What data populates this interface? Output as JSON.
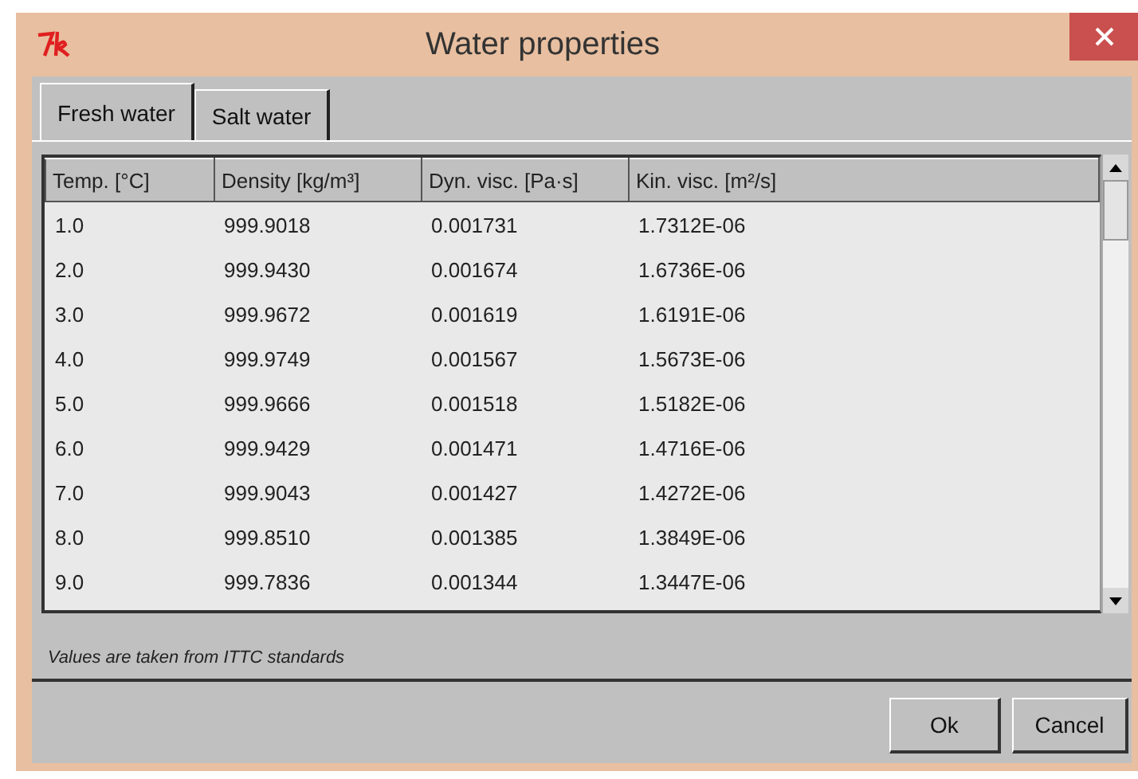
{
  "window": {
    "title": "Water properties"
  },
  "tabs": [
    {
      "label": "Fresh water",
      "selected": true
    },
    {
      "label": "Salt water",
      "selected": false
    }
  ],
  "table": {
    "columns": [
      "Temp. [°C]",
      "Density [kg/m³]",
      "Dyn. visc. [Pa·s]",
      "Kin. visc. [m²/s]"
    ],
    "rows": [
      [
        "1.0",
        "999.9018",
        "0.001731",
        "1.7312E-06"
      ],
      [
        "2.0",
        "999.9430",
        "0.001674",
        "1.6736E-06"
      ],
      [
        "3.0",
        "999.9672",
        "0.001619",
        "1.6191E-06"
      ],
      [
        "4.0",
        "999.9749",
        "0.001567",
        "1.5673E-06"
      ],
      [
        "5.0",
        "999.9666",
        "0.001518",
        "1.5182E-06"
      ],
      [
        "6.0",
        "999.9429",
        "0.001471",
        "1.4716E-06"
      ],
      [
        "7.0",
        "999.9043",
        "0.001427",
        "1.4272E-06"
      ],
      [
        "8.0",
        "999.8510",
        "0.001385",
        "1.3849E-06"
      ],
      [
        "9.0",
        "999.7836",
        "0.001344",
        "1.3447E-06"
      ]
    ]
  },
  "note": "Values are taken from ITTC standards",
  "buttons": [
    "Ok",
    "Cancel"
  ]
}
